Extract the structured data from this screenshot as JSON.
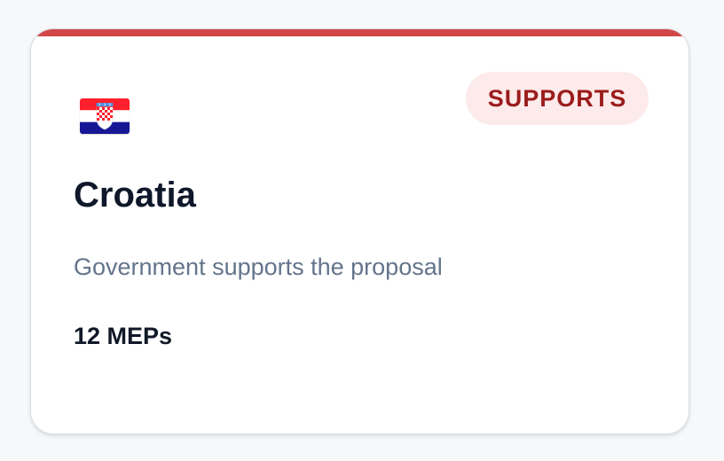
{
  "card": {
    "country": "Croatia",
    "status_badge": "SUPPORTS",
    "description": "Government supports the proposal",
    "meps": "12 MEPs",
    "flag_icon": "croatia-flag-icon"
  },
  "colors": {
    "accent": "#d14747",
    "badge_background": "#fdeaea",
    "badge_text": "#9b1c1c",
    "title": "#0f172a",
    "description": "#64748b",
    "meta_text": "#111827"
  }
}
